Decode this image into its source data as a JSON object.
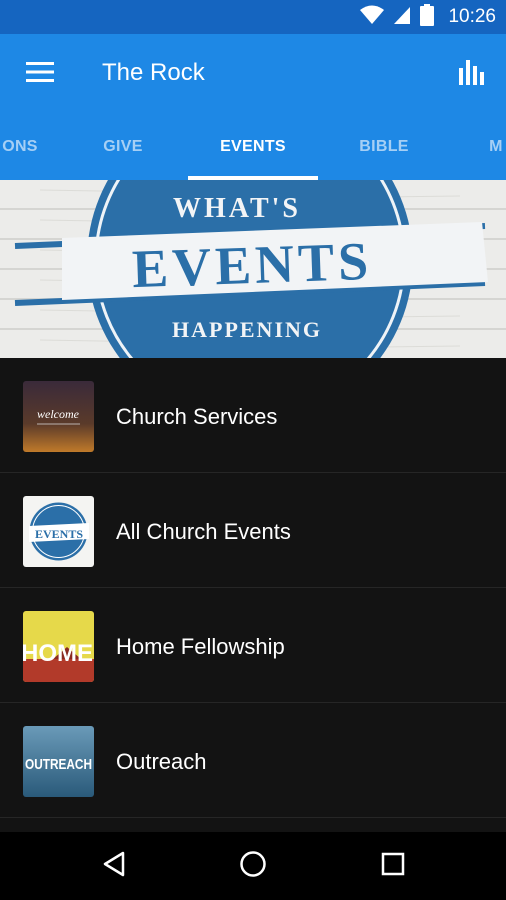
{
  "status_bar": {
    "time": "10:26",
    "icons": [
      "wifi-icon",
      "signal-icon",
      "battery-icon"
    ]
  },
  "app_bar": {
    "title": "The Rock",
    "menu_icon": "hamburger-menu-icon",
    "action_icon": "bar-chart-icon"
  },
  "tabs": [
    {
      "label": "ONS",
      "active": false
    },
    {
      "label": "GIVE",
      "active": false
    },
    {
      "label": "EVENTS",
      "active": true
    },
    {
      "label": "BIBLE",
      "active": false
    },
    {
      "label": "M",
      "active": false
    }
  ],
  "banner": {
    "top_text": "WHAT'S",
    "main_text": "EVENTS",
    "bottom_text": "HAPPENING"
  },
  "list_items": [
    {
      "label": "Church Services",
      "thumb_text": "welcome",
      "thumb_icon": "welcome-thumbnail"
    },
    {
      "label": "All Church Events",
      "thumb_text": "EVENTS",
      "thumb_icon": "events-thumbnail"
    },
    {
      "label": "Home Fellowship",
      "thumb_text": "HOME",
      "thumb_icon": "home-thumbnail"
    },
    {
      "label": "Outreach",
      "thumb_text": "OUTREACH",
      "thumb_icon": "outreach-thumbnail"
    }
  ],
  "nav_bar": {
    "icons": [
      "back-icon",
      "home-icon",
      "recents-icon"
    ]
  },
  "colors": {
    "status_bar": "#1565C0",
    "app_bar": "#1E88E5",
    "list_background": "#131313",
    "banner_blue": "#2B6FA8"
  }
}
